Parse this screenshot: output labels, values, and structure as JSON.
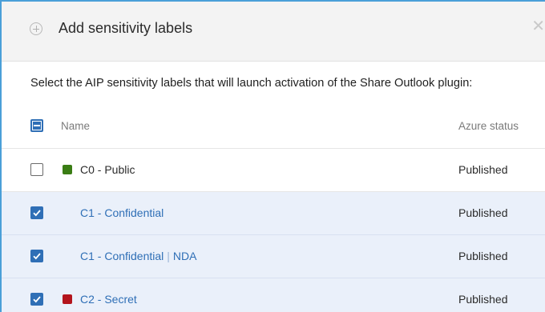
{
  "dialog": {
    "title": "Add sensitivity labels",
    "instruction": "Select the AIP sensitivity labels that will launch activation of the Share Outlook plugin:"
  },
  "table": {
    "headers": {
      "name": "Name",
      "status": "Azure status"
    },
    "rows": [
      {
        "checked": false,
        "color": "#3a7d14",
        "name": "C0 - Public",
        "sub": "",
        "status": "Published",
        "link": false
      },
      {
        "checked": true,
        "color": "",
        "name": "C1 - Confidential",
        "sub": "",
        "status": "Published",
        "link": true
      },
      {
        "checked": true,
        "color": "",
        "name": "C1 - Confidential",
        "sub": "NDA",
        "status": "Published",
        "link": true
      },
      {
        "checked": true,
        "color": "#b3141c",
        "name": "C2 - Secret",
        "sub": "",
        "status": "Published",
        "link": true
      }
    ]
  },
  "colors": {
    "accent": "#2f6fb6",
    "selected_row": "#eaf0fa",
    "frame_border": "#4a9fd8"
  },
  "icons": {
    "add": "plus-circle-icon",
    "close": "close-icon",
    "check": "checkmark-icon"
  }
}
